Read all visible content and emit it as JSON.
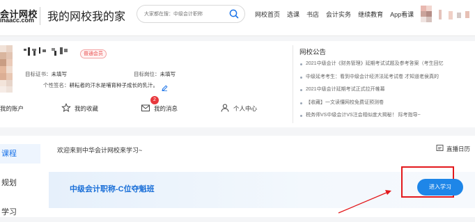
{
  "header": {
    "logo_text": "会计网校",
    "logo_url": "inaacc.com",
    "slogan": "我的网校我的家",
    "search_placeholder": "大家都在搜：中级会计职称",
    "nav": [
      "网校首页",
      "选课",
      "书店",
      "会计实务",
      "继续教育",
      "App看课"
    ]
  },
  "profile": {
    "vip_badge": "普通会员",
    "target_cert_label": "目标证书：",
    "target_cert_value": "未填写",
    "target_job_label": "目标岗位：",
    "target_job_value": "未填写",
    "signature_label": "个性签名：",
    "signature_value": "耕耘者的汗水是哺育种子成长的乳汁。",
    "actions": {
      "account": "我的账户",
      "favorites": "我的收藏",
      "messages": "我的消息",
      "personal_center": "个人中心"
    },
    "message_count": "2"
  },
  "notices": {
    "title": "网校公告",
    "items": [
      "2021中级会计《财务管理》延期考试试题及参考答案（考生回忆",
      "中级延考考生：看到中级会计经济法延考试卷 才知道老侯真的",
      "2021中级会计延期考试正式拉开帷幕",
      "【收藏】一文读懂网校免费证预测卷",
      "税务师VS中级会计VS注会相似度大揭秘！ 际考指导~"
    ]
  },
  "sidebar": {
    "items": [
      "课程",
      "规划",
      "学习"
    ]
  },
  "main": {
    "welcome": "欢迎来到中华会计网校来学习~",
    "calendar": "直播日历",
    "course_title": "中级会计职称-C位夺魁班",
    "enter_button": "进入学习"
  }
}
